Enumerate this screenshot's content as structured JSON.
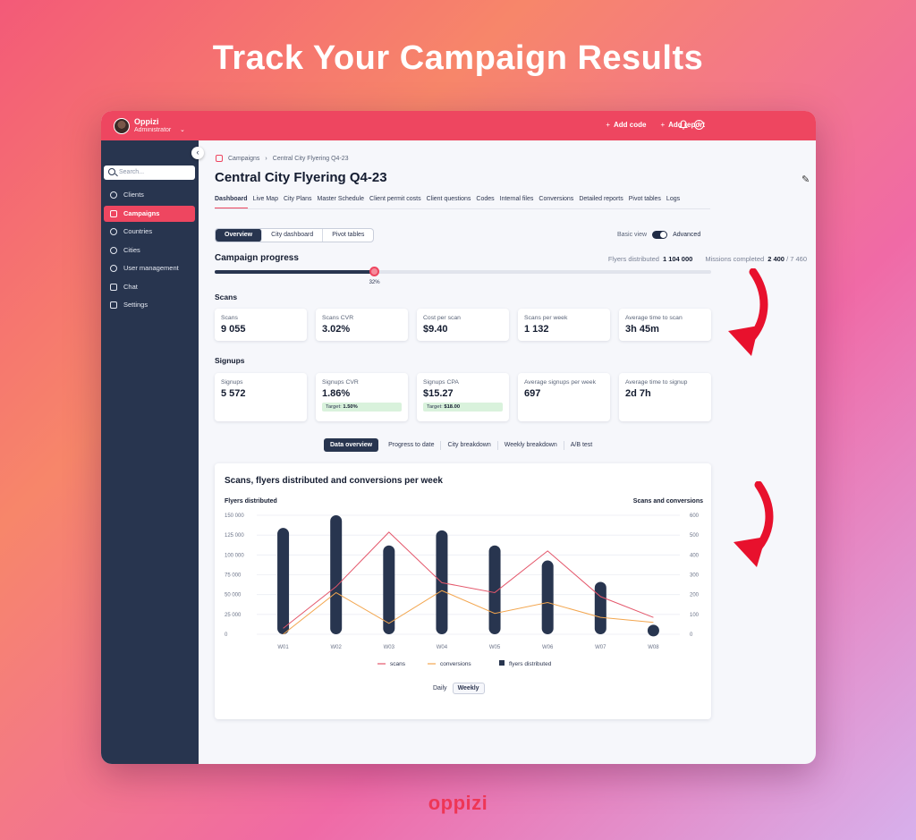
{
  "headline": "Track Your Campaign Results",
  "brand": "oppizi",
  "topbar": {
    "org": "Oppizi",
    "role": "Administrator",
    "add_code": "Add code",
    "add_report": "Add report"
  },
  "sidebar": {
    "search_placeholder": "Search...",
    "items": [
      {
        "label": "Clients"
      },
      {
        "label": "Campaigns"
      },
      {
        "label": "Countries"
      },
      {
        "label": "Cities"
      },
      {
        "label": "User management"
      },
      {
        "label": "Chat"
      },
      {
        "label": "Settings"
      }
    ]
  },
  "breadcrumb": {
    "root": "Campaigns",
    "current": "Central City Flyering Q4-23"
  },
  "page_title": "Central City Flyering Q4-23",
  "tabs": [
    "Dashboard",
    "Live Map",
    "City Plans",
    "Master Schedule",
    "Client permit costs",
    "Client questions",
    "Codes",
    "Internal files",
    "Conversions",
    "Detailed reports",
    "Pivot tables",
    "Logs"
  ],
  "segments": [
    "Overview",
    "City dashboard",
    "Pivot tables"
  ],
  "view_toggle": {
    "basic": "Basic view",
    "advanced": "Advanced"
  },
  "campaign_progress": {
    "title": "Campaign progress",
    "flyers_label": "Flyers distributed",
    "flyers_value": "1 104 000",
    "missions_label": "Missions completed",
    "missions_value": "2 400",
    "missions_total": "/ 7 460",
    "percent_label": "32%",
    "progress": 0.32
  },
  "scans": {
    "title": "Scans",
    "cards": [
      {
        "label": "Scans",
        "value": "9 055"
      },
      {
        "label": "Scans CVR",
        "value": "3.02%"
      },
      {
        "label": "Cost per scan",
        "value": "$9.40"
      },
      {
        "label": "Scans per week",
        "value": "1 132"
      },
      {
        "label": "Average time to scan",
        "value": "3h 45m"
      }
    ]
  },
  "signups": {
    "title": "Signups",
    "cards": [
      {
        "label": "Signups",
        "value": "5 572"
      },
      {
        "label": "Signups CVR",
        "value": "1.86%",
        "target_label": "Target:",
        "target_value": "1.50%"
      },
      {
        "label": "Signups CPA",
        "value": "$15.27",
        "target_label": "Target:",
        "target_value": "$18.00"
      },
      {
        "label": "Average signups per week",
        "value": "697"
      },
      {
        "label": "Average time to signup",
        "value": "2d 7h"
      }
    ]
  },
  "subtabs": [
    "Data overview",
    "Progress to date",
    "City breakdown",
    "Weekly breakdown",
    "A/B test"
  ],
  "period": {
    "daily": "Daily",
    "weekly": "Weekly"
  },
  "colors": {
    "accent": "#ee4660",
    "navy": "#28354f",
    "scans": "#e4576b",
    "conversions": "#f3a64f"
  },
  "chart_data": {
    "type": "bar",
    "title": "Scans, flyers distributed and conversions per week",
    "ylabel_left": "Flyers distributed",
    "ylabel_right": "Scans and conversions",
    "categories": [
      "W01",
      "W02",
      "W03",
      "W04",
      "W05",
      "W06",
      "W07",
      "W08"
    ],
    "ylim_left": [
      0,
      150000
    ],
    "ylim_right": [
      0,
      600
    ],
    "left_ticks": [
      "150 000",
      "125 000",
      "100 000",
      "75 000",
      "50 000",
      "25 000",
      "0"
    ],
    "right_ticks": [
      "600",
      "500",
      "400",
      "300",
      "200",
      "100",
      "0"
    ],
    "series": [
      {
        "name": "flyers distributed",
        "type": "bar",
        "axis": "left",
        "values": [
          134000,
          150000,
          112000,
          131000,
          112000,
          93000,
          66000,
          12000
        ]
      },
      {
        "name": "scans",
        "type": "line",
        "axis": "right",
        "values": [
          30,
          240,
          515,
          260,
          210,
          420,
          190,
          85
        ]
      },
      {
        "name": "conversions",
        "type": "line",
        "axis": "right",
        "values": [
          0,
          210,
          55,
          220,
          105,
          160,
          85,
          60
        ]
      }
    ],
    "legend": "bottom",
    "grid": true
  }
}
